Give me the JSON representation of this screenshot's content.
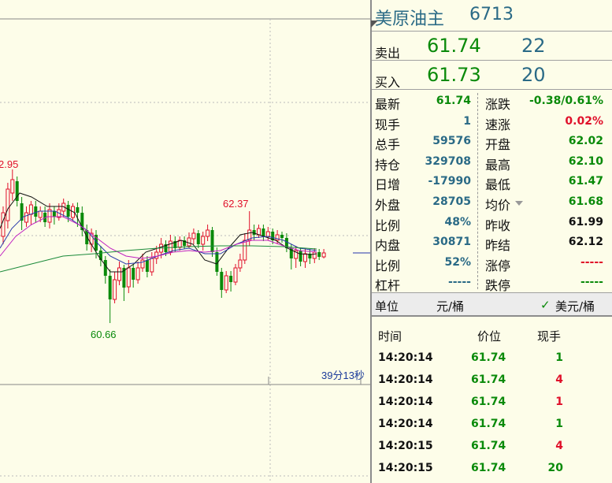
{
  "chart": {
    "high_label": "2.95",
    "mid_high_label": "62.37",
    "low_label": "60.66",
    "countdown": "39分13秒"
  },
  "header": {
    "name": "美原油主",
    "code": "6713"
  },
  "quote": {
    "sell_label": "卖出",
    "sell_price": "61.74",
    "sell_volume": "22",
    "buy_label": "买入",
    "buy_price": "61.73",
    "buy_volume": "20"
  },
  "stats_left": [
    {
      "label": "最新",
      "value": "61.74",
      "color": "green"
    },
    {
      "label": "现手",
      "value": "1",
      "color": "blue"
    },
    {
      "label": "总手",
      "value": "59576",
      "color": "blue"
    },
    {
      "label": "持仓",
      "value": "329708",
      "color": "blue"
    },
    {
      "label": "日增",
      "value": "-17990",
      "color": "blue"
    },
    {
      "label": "外盘",
      "value": "28705",
      "color": "blue"
    },
    {
      "label": "比例",
      "value": "48%",
      "color": "blue"
    },
    {
      "label": "内盘",
      "value": "30871",
      "color": "blue"
    },
    {
      "label": "比例",
      "value": "52%",
      "color": "blue"
    },
    {
      "label": "杠杆",
      "value": "-----",
      "color": "blue"
    }
  ],
  "stats_right": [
    {
      "label": "涨跌",
      "value": "-0.38/0.61%",
      "color": "green"
    },
    {
      "label": "速涨",
      "value": "0.02%",
      "color": "red"
    },
    {
      "label": "开盘",
      "value": "62.02",
      "color": "green"
    },
    {
      "label": "最高",
      "value": "62.10",
      "color": "green"
    },
    {
      "label": "最低",
      "value": "61.47",
      "color": "green"
    },
    {
      "label": "均价",
      "value": "61.68",
      "color": "green"
    },
    {
      "label": "昨收",
      "value": "61.99",
      "color": "black"
    },
    {
      "label": "昨结",
      "value": "62.12",
      "color": "black"
    },
    {
      "label": "涨停",
      "value": "-----",
      "color": "red"
    },
    {
      "label": "跌停",
      "value": "-----",
      "color": "green"
    }
  ],
  "unit": {
    "label": "单位",
    "option1": "元/桶",
    "option2": "美元/桶",
    "check": "✓"
  },
  "ticks": {
    "headers": [
      "时间",
      "价位",
      "现手"
    ],
    "rows": [
      {
        "time": "14:20:14",
        "price": "61.74",
        "vol": "1",
        "color": "green"
      },
      {
        "time": "14:20:14",
        "price": "61.74",
        "vol": "4",
        "color": "red"
      },
      {
        "time": "14:20:14",
        "price": "61.74",
        "vol": "1",
        "color": "red"
      },
      {
        "time": "14:20:14",
        "price": "61.74",
        "vol": "1",
        "color": "green"
      },
      {
        "time": "14:20:15",
        "price": "61.74",
        "vol": "4",
        "color": "red"
      },
      {
        "time": "14:20:15",
        "price": "61.74",
        "vol": "20",
        "color": "green"
      }
    ]
  },
  "colors": {
    "up": "#e0102a",
    "down": "#0a8a0a",
    "accent": "#2a6a86",
    "background": "#fdfde9"
  }
}
